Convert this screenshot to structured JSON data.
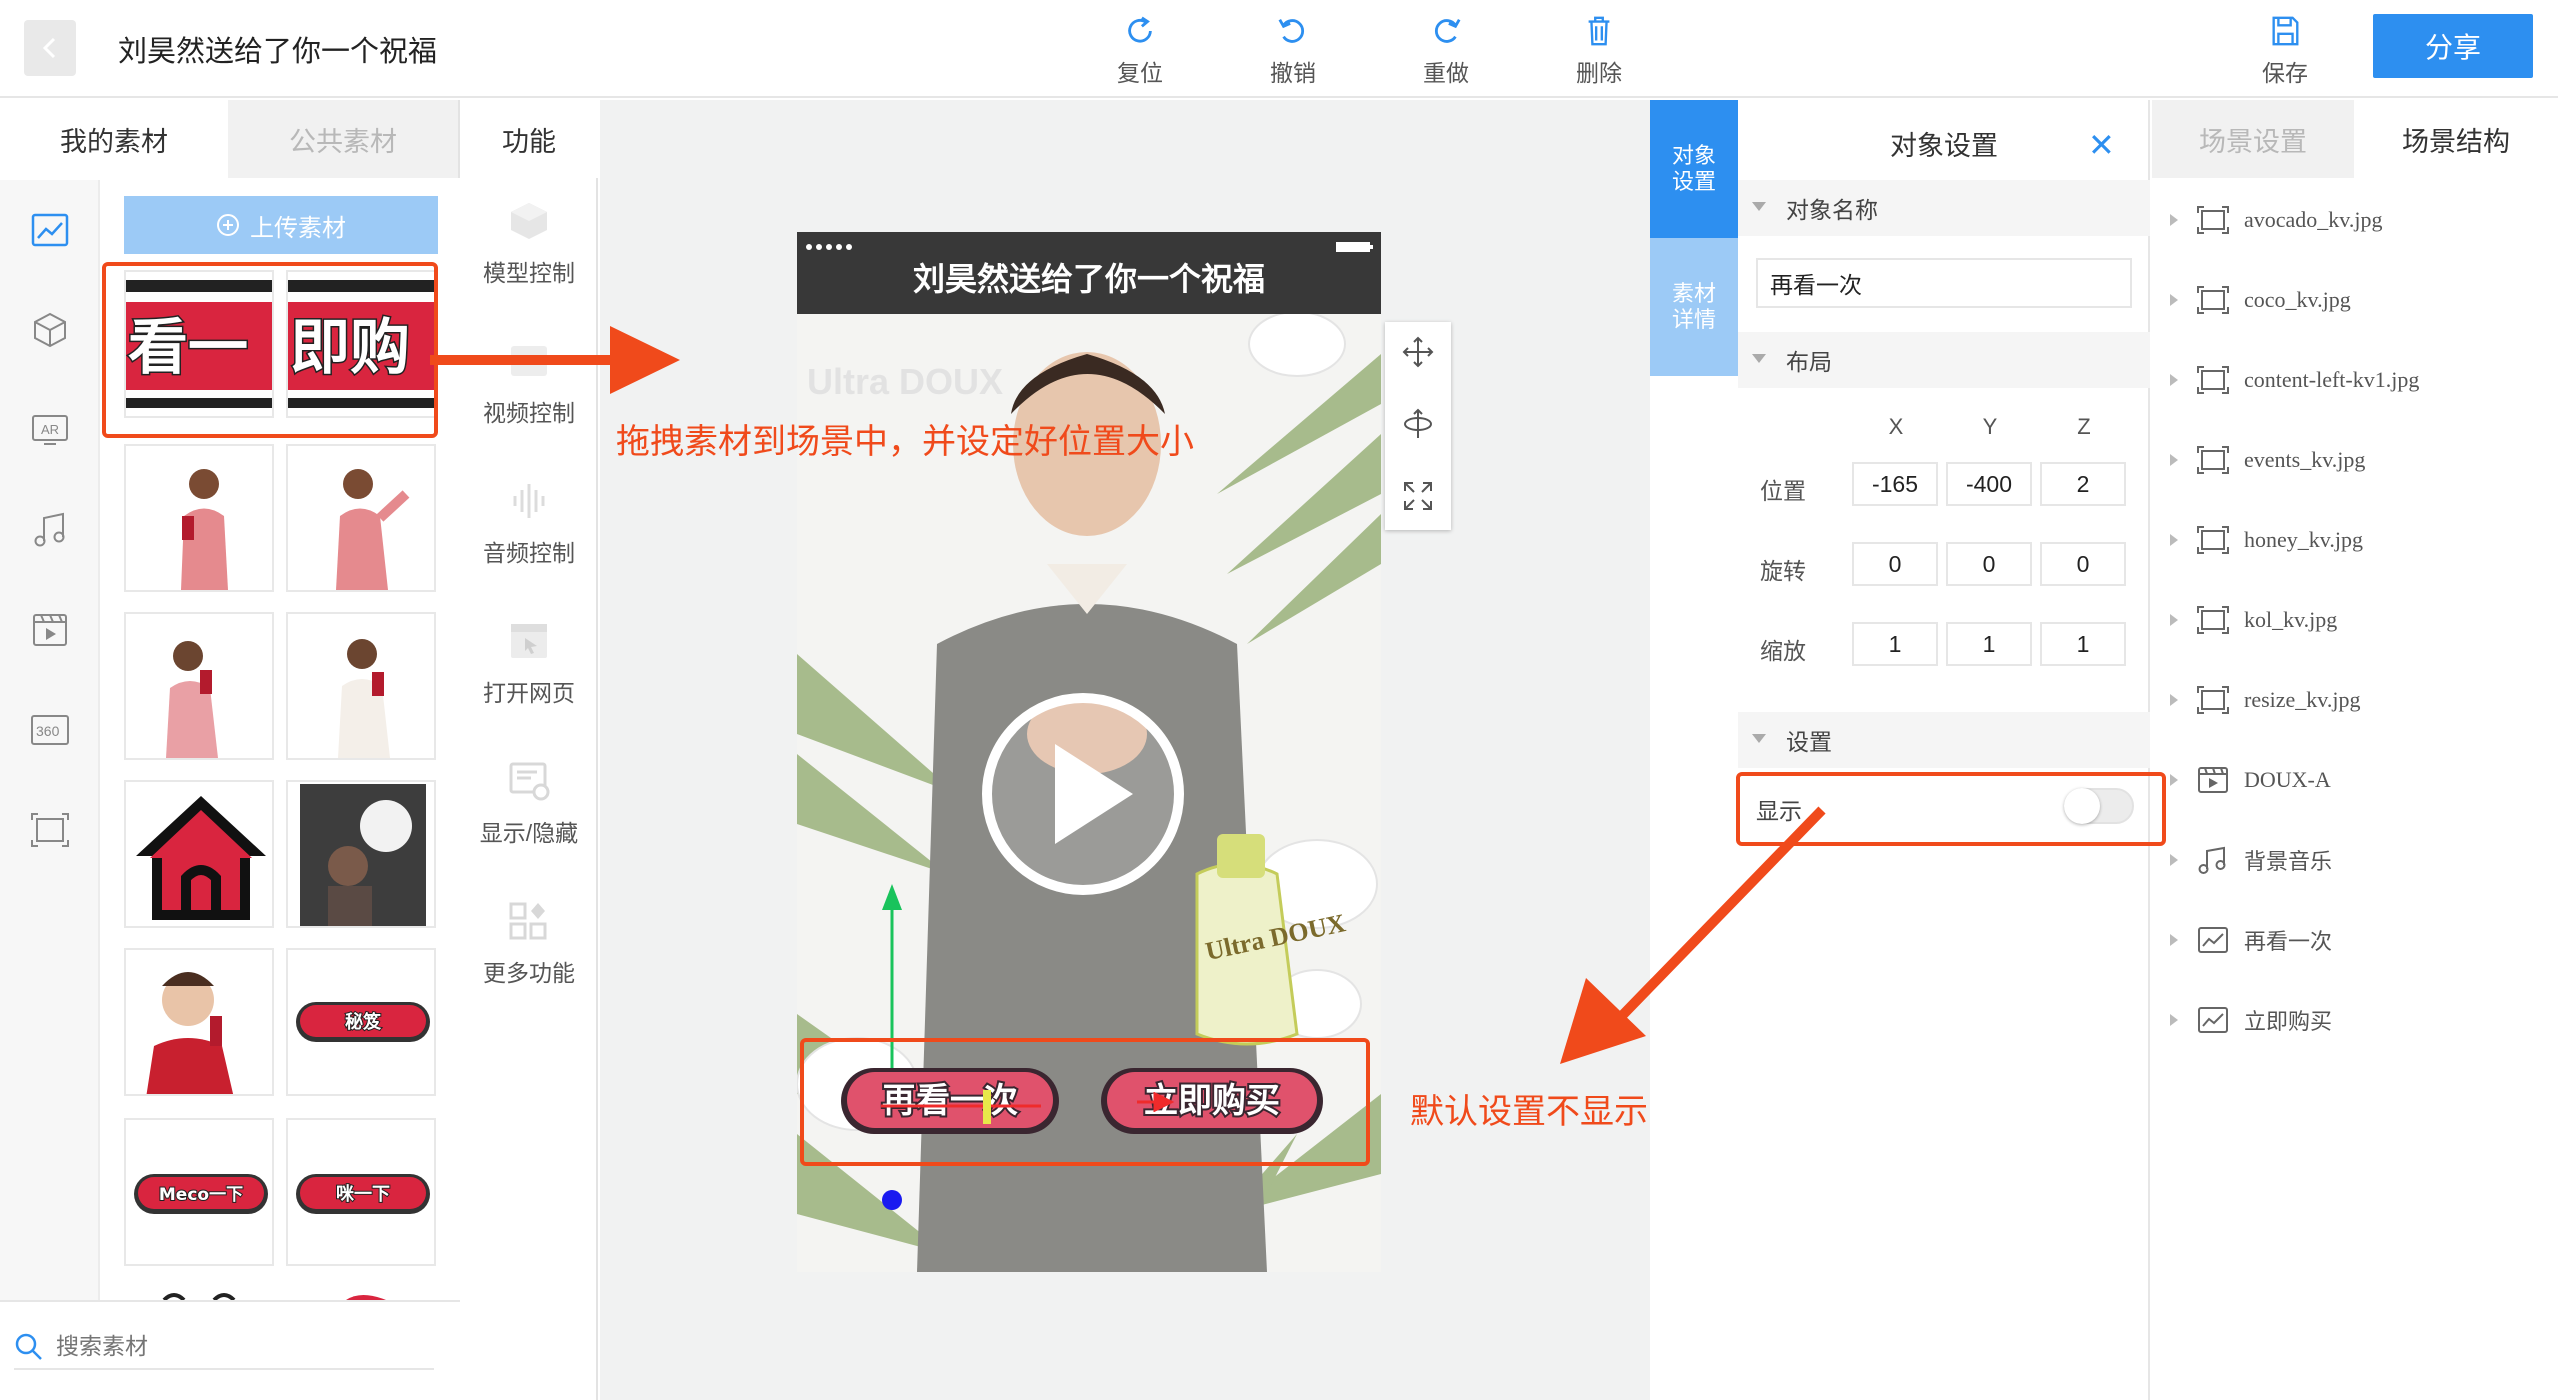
{
  "window": {
    "title": "刘昊然送给了你一个祝福"
  },
  "toolbar": {
    "reset_label": "复位",
    "undo_label": "撤销",
    "redo_label": "重做",
    "delete_label": "删除",
    "save_label": "保存",
    "share_label": "分享"
  },
  "left_panel": {
    "tabs": [
      "我的素材",
      "公共素材",
      "功能"
    ],
    "upload_label": "上传素材",
    "search_placeholder": "搜索素材",
    "categories": [
      "image-icon",
      "cube-icon",
      "ar-icon",
      "music-icon",
      "video-icon",
      "360-icon",
      "frame-icon"
    ],
    "assets": [
      {
        "label": "看一",
        "kind": "banner"
      },
      {
        "label": "即购",
        "kind": "banner"
      },
      {
        "label": "",
        "kind": "person"
      },
      {
        "label": "",
        "kind": "person"
      },
      {
        "label": "",
        "kind": "person"
      },
      {
        "label": "",
        "kind": "person"
      },
      {
        "label": "",
        "kind": "house"
      },
      {
        "label": "",
        "kind": "poster"
      },
      {
        "label": "",
        "kind": "person"
      },
      {
        "label": "秘笈",
        "kind": "pill"
      },
      {
        "label": "Meco一下",
        "kind": "pill"
      },
      {
        "label": "咪一下",
        "kind": "pill"
      }
    ],
    "functions": [
      {
        "label": "模型控制",
        "icon": "cube-icon"
      },
      {
        "label": "视频控制",
        "icon": "video-icon"
      },
      {
        "label": "音频控制",
        "icon": "audio-wave-icon"
      },
      {
        "label": "打开网页",
        "icon": "browser-icon"
      },
      {
        "label": "显示/隐藏",
        "icon": "display-icon"
      },
      {
        "label": "更多功能",
        "icon": "grid-icon"
      }
    ]
  },
  "canvas": {
    "phone_title": "刘昊然送给了你一个祝福",
    "brand_text": "Ultra DOUX",
    "replay_button": "再看一次",
    "buy_button": "立即购买"
  },
  "side_tabs": {
    "object": "对象设置",
    "material": "素材详情"
  },
  "object_settings": {
    "title": "对象设置",
    "name_section": "对象名称",
    "name_value": "再看一次",
    "layout_section": "布局",
    "axes": [
      "X",
      "Y",
      "Z"
    ],
    "position_label": "位置",
    "position": [
      "-165",
      "-400",
      "2"
    ],
    "rotation_label": "旋转",
    "rotation": [
      "0",
      "0",
      "0"
    ],
    "scale_label": "缩放",
    "scale": [
      "1",
      "1",
      "1"
    ],
    "settings_section": "设置",
    "show_label": "显示",
    "show_enabled": false
  },
  "scene": {
    "tabs": [
      "场景设置",
      "场景结构"
    ],
    "items": [
      {
        "label": "avocado_kv.jpg",
        "icon": "frame-icon"
      },
      {
        "label": "coco_kv.jpg",
        "icon": "frame-icon"
      },
      {
        "label": "content-left-kv1.jpg",
        "icon": "frame-icon"
      },
      {
        "label": "events_kv.jpg",
        "icon": "frame-icon"
      },
      {
        "label": "honey_kv.jpg",
        "icon": "frame-icon"
      },
      {
        "label": "kol_kv.jpg",
        "icon": "frame-icon"
      },
      {
        "label": "resize_kv.jpg",
        "icon": "frame-icon"
      },
      {
        "label": "DOUX-A",
        "icon": "video-icon"
      },
      {
        "label": "背景音乐",
        "icon": "music-icon"
      },
      {
        "label": "再看一次",
        "icon": "image-icon"
      },
      {
        "label": "立即购买",
        "icon": "image-icon"
      }
    ]
  },
  "annotations": {
    "drag_hint": "拖拽素材到场景中，并设定好位置大小",
    "default_hint": "默认设置不显示"
  },
  "colors": {
    "accent": "#2d8ff0",
    "accent_light": "#9ccaf6",
    "annotation": "#f04a1b",
    "pill_red": "#d9253f"
  }
}
